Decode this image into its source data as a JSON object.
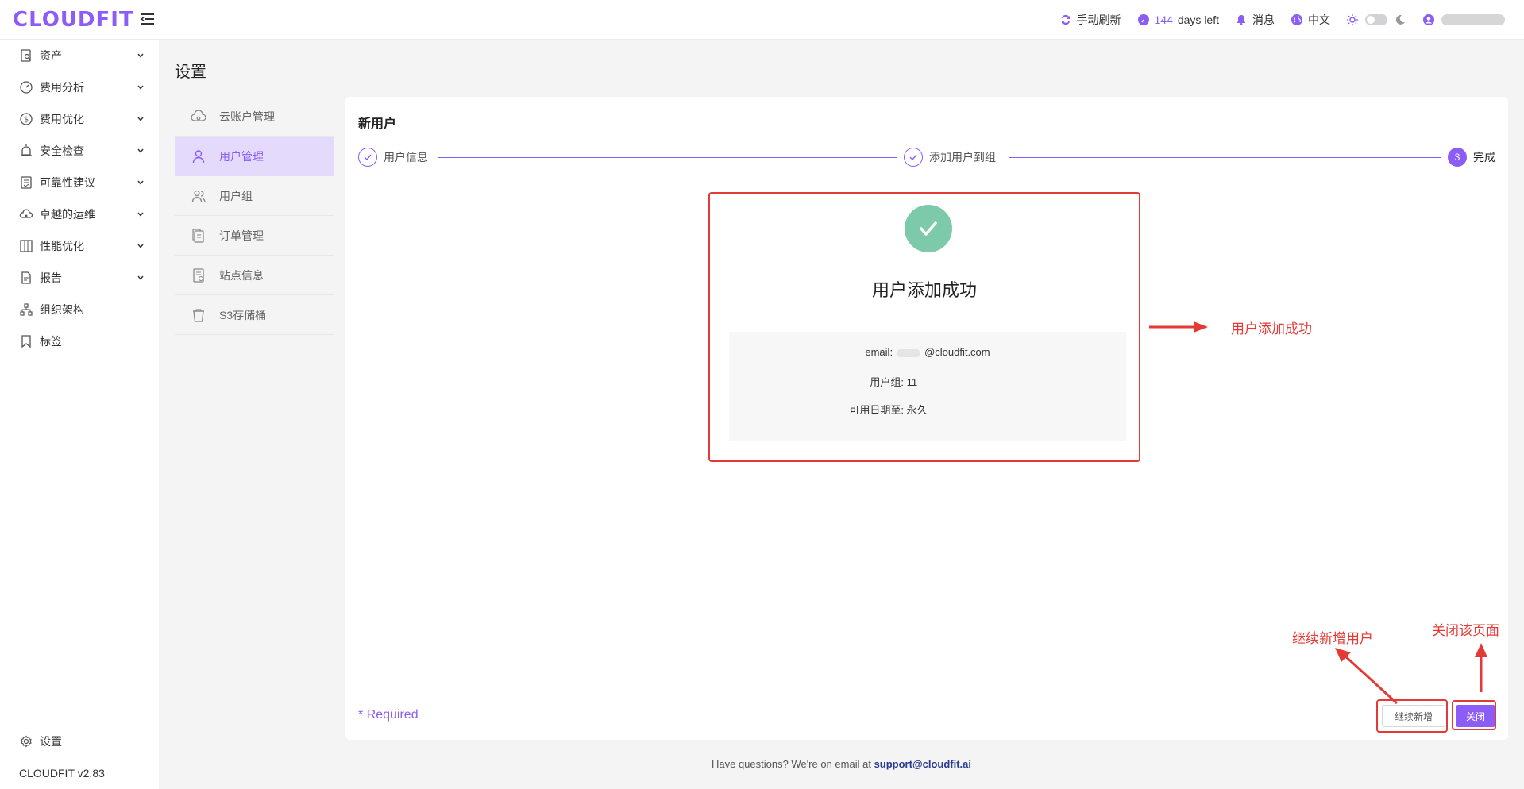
{
  "app": {
    "logo": "CLOUDFIT"
  },
  "header": {
    "refresh": "手动刷新",
    "days_count": "144",
    "days_text": "days left",
    "messages": "消息",
    "language": "中文"
  },
  "sidebar": {
    "items": [
      {
        "label": "资产",
        "icon": "asset-icon",
        "expandable": true
      },
      {
        "label": "费用分析",
        "icon": "gauge-icon",
        "expandable": true
      },
      {
        "label": "费用优化",
        "icon": "dollar-icon",
        "expandable": true
      },
      {
        "label": "安全检查",
        "icon": "alarm-icon",
        "expandable": true
      },
      {
        "label": "可靠性建议",
        "icon": "list-check-icon",
        "expandable": true
      },
      {
        "label": "卓越的运维",
        "icon": "cloud-gear-icon",
        "expandable": true
      },
      {
        "label": "性能优化",
        "icon": "grid-icon",
        "expandable": true
      },
      {
        "label": "报告",
        "icon": "report-icon",
        "expandable": true
      },
      {
        "label": "组织架构",
        "icon": "org-icon",
        "expandable": false
      },
      {
        "label": "标签",
        "icon": "tag-icon",
        "expandable": false
      }
    ],
    "settings": "设置",
    "version": "CLOUDFIT v2.83"
  },
  "page": {
    "title": "设置"
  },
  "settings_menu": [
    {
      "label": "云账户管理",
      "icon": "cloud-account-icon"
    },
    {
      "label": "用户管理",
      "icon": "user-icon",
      "active": true
    },
    {
      "label": "用户组",
      "icon": "users-icon"
    },
    {
      "label": "订单管理",
      "icon": "order-icon"
    },
    {
      "label": "站点信息",
      "icon": "site-icon"
    },
    {
      "label": "S3存储桶",
      "icon": "bucket-icon"
    }
  ],
  "panel": {
    "title": "新用户",
    "steps": [
      {
        "label": "用户信息",
        "state": "done"
      },
      {
        "label": "添加用户到组",
        "state": "done"
      },
      {
        "label": "完成",
        "state": "current",
        "number": "3"
      }
    ],
    "result": {
      "title": "用户添加成功",
      "email_label": "email:",
      "email_value": "@cloudfit.com",
      "group_label": "用户组:",
      "group_value": "11",
      "valid_label": "可用日期至:",
      "valid_value": "永久"
    },
    "required": "* Required",
    "buttons": {
      "continue": "继续新增",
      "close": "关闭"
    }
  },
  "annotations": {
    "success": "用户添加成功",
    "continue": "继续新增用户",
    "close": "关闭该页面"
  },
  "footer": {
    "text": "Have questions? We're on email at ",
    "email": "support@cloudfit.ai"
  },
  "colors": {
    "accent": "#8b5cf6",
    "annotation": "#e53935",
    "success": "#7ccaa9"
  }
}
